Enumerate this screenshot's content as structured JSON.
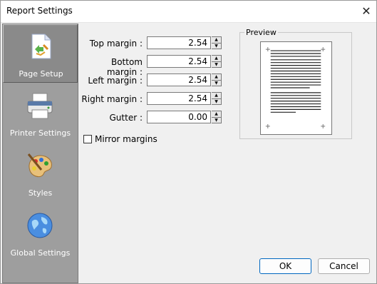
{
  "window": {
    "title": "Report Settings",
    "close_glyph": "✕"
  },
  "sidebar": {
    "items": [
      {
        "label": "Page Setup",
        "icon": "page-setup-icon",
        "active": true
      },
      {
        "label": "Printer Settings",
        "icon": "printer-icon",
        "active": false
      },
      {
        "label": "Styles",
        "icon": "palette-icon",
        "active": false
      },
      {
        "label": "Global Settings",
        "icon": "globe-icon",
        "active": false
      }
    ]
  },
  "margins": {
    "top": {
      "label": "Top margin :",
      "value": "2.54"
    },
    "bottom": {
      "label": "Bottom margin :",
      "value": "2.54"
    },
    "left": {
      "label": "Left margin :",
      "value": "2.54"
    },
    "right": {
      "label": "Right margin :",
      "value": "2.54"
    },
    "gutter": {
      "label": "Gutter :",
      "value": "0.00"
    }
  },
  "mirror": {
    "label": "Mirror margins",
    "checked": false
  },
  "preview": {
    "label": "Preview"
  },
  "buttons": {
    "ok": "OK",
    "cancel": "Cancel"
  },
  "colors": {
    "sidebar": "#9e9e9e",
    "ok_border": "#0067c0"
  }
}
